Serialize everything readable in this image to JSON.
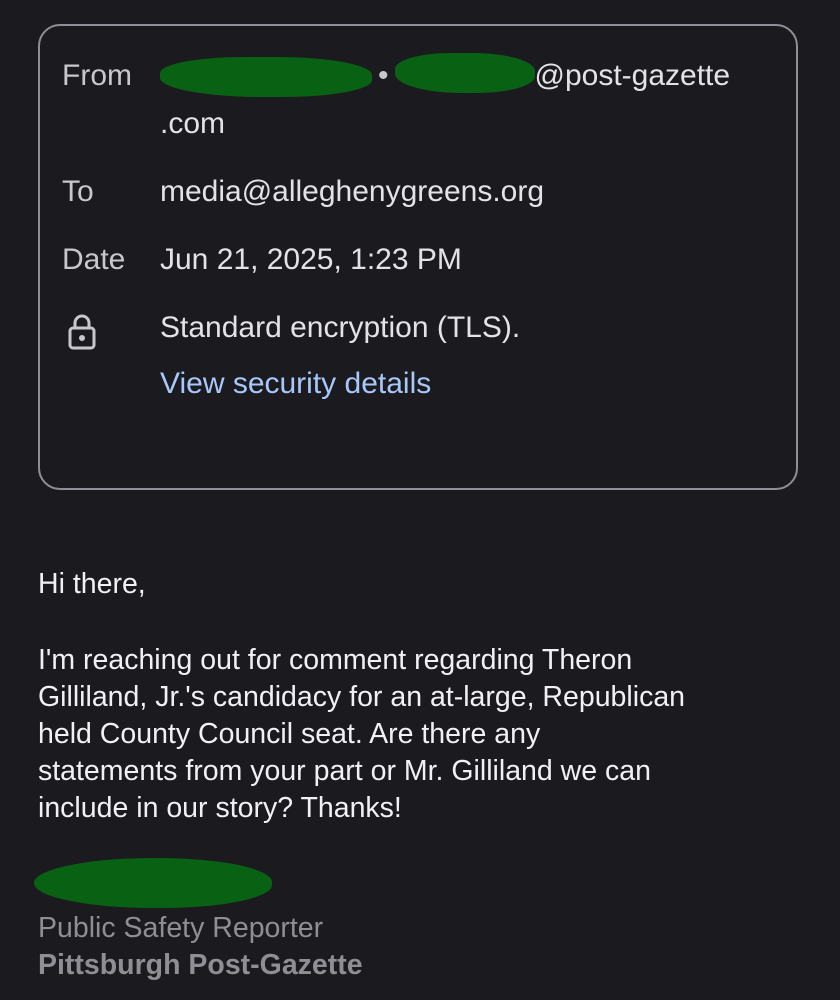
{
  "details": {
    "from_label": "From",
    "from_name_visible": "",
    "from_email_suffix": "@post-gazette",
    "from_email_tail": ".com",
    "separator": "•",
    "to_label": "To",
    "to_value": "media@alleghenygreens.org",
    "date_label": "Date",
    "date_value": "Jun 21, 2025, 1:23 PM",
    "encryption_text": "Standard encryption (TLS).",
    "security_link": "View security details",
    "lock_icon": "lock-icon"
  },
  "email": {
    "greeting": "Hi there,",
    "lines": [
      "I'm reaching out for comment regarding Theron",
      "Gilliland, Jr.'s candidacy for an at-large, Republican",
      "held County Council seat. Are there any",
      "statements from your part or Mr. Gilliland we can",
      "include in our story? Thanks!"
    ]
  },
  "signature": {
    "title": "Public Safety Reporter",
    "organization": "Pittsburgh Post-Gazette"
  },
  "colors": {
    "background": "#1b1b1f",
    "link": "#a8c7fa",
    "redaction": "#096114",
    "muted": "#8e8e94"
  }
}
